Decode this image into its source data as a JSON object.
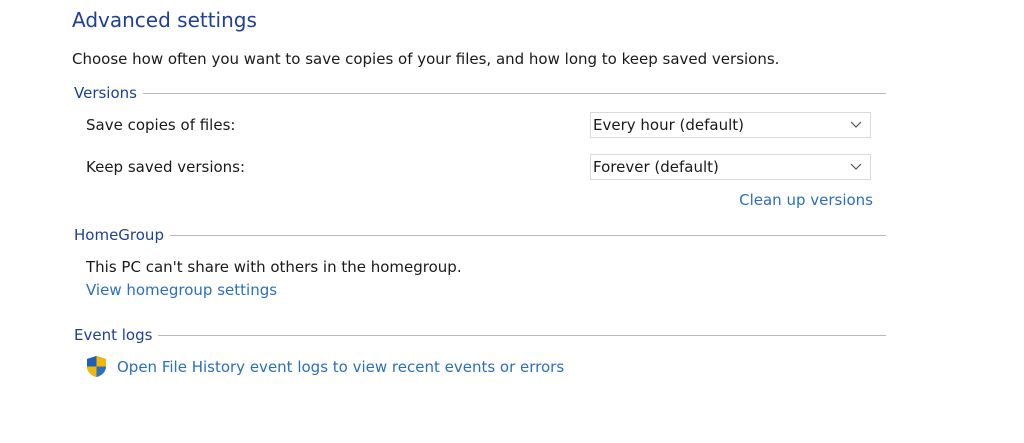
{
  "page": {
    "title": "Advanced settings",
    "description": "Choose how often you want to save copies of your files, and how long to keep saved versions."
  },
  "versions": {
    "heading": "Versions",
    "save_copies_label": "Save copies of files:",
    "save_copies_value": "Every hour (default)",
    "keep_versions_label": "Keep saved versions:",
    "keep_versions_value": "Forever (default)",
    "clean_up_link": "Clean up versions"
  },
  "homegroup": {
    "heading": "HomeGroup",
    "status_text": "This PC can't share with others in the homegroup.",
    "settings_link": "View homegroup settings"
  },
  "event_logs": {
    "heading": "Event logs",
    "open_link": "Open File History event logs to view recent events or errors",
    "icon": "uac-shield-icon"
  },
  "colors": {
    "heading_blue": "#1e3f9c",
    "link_blue": "#2a6fc4",
    "rule_gray": "#b8b8b8"
  }
}
